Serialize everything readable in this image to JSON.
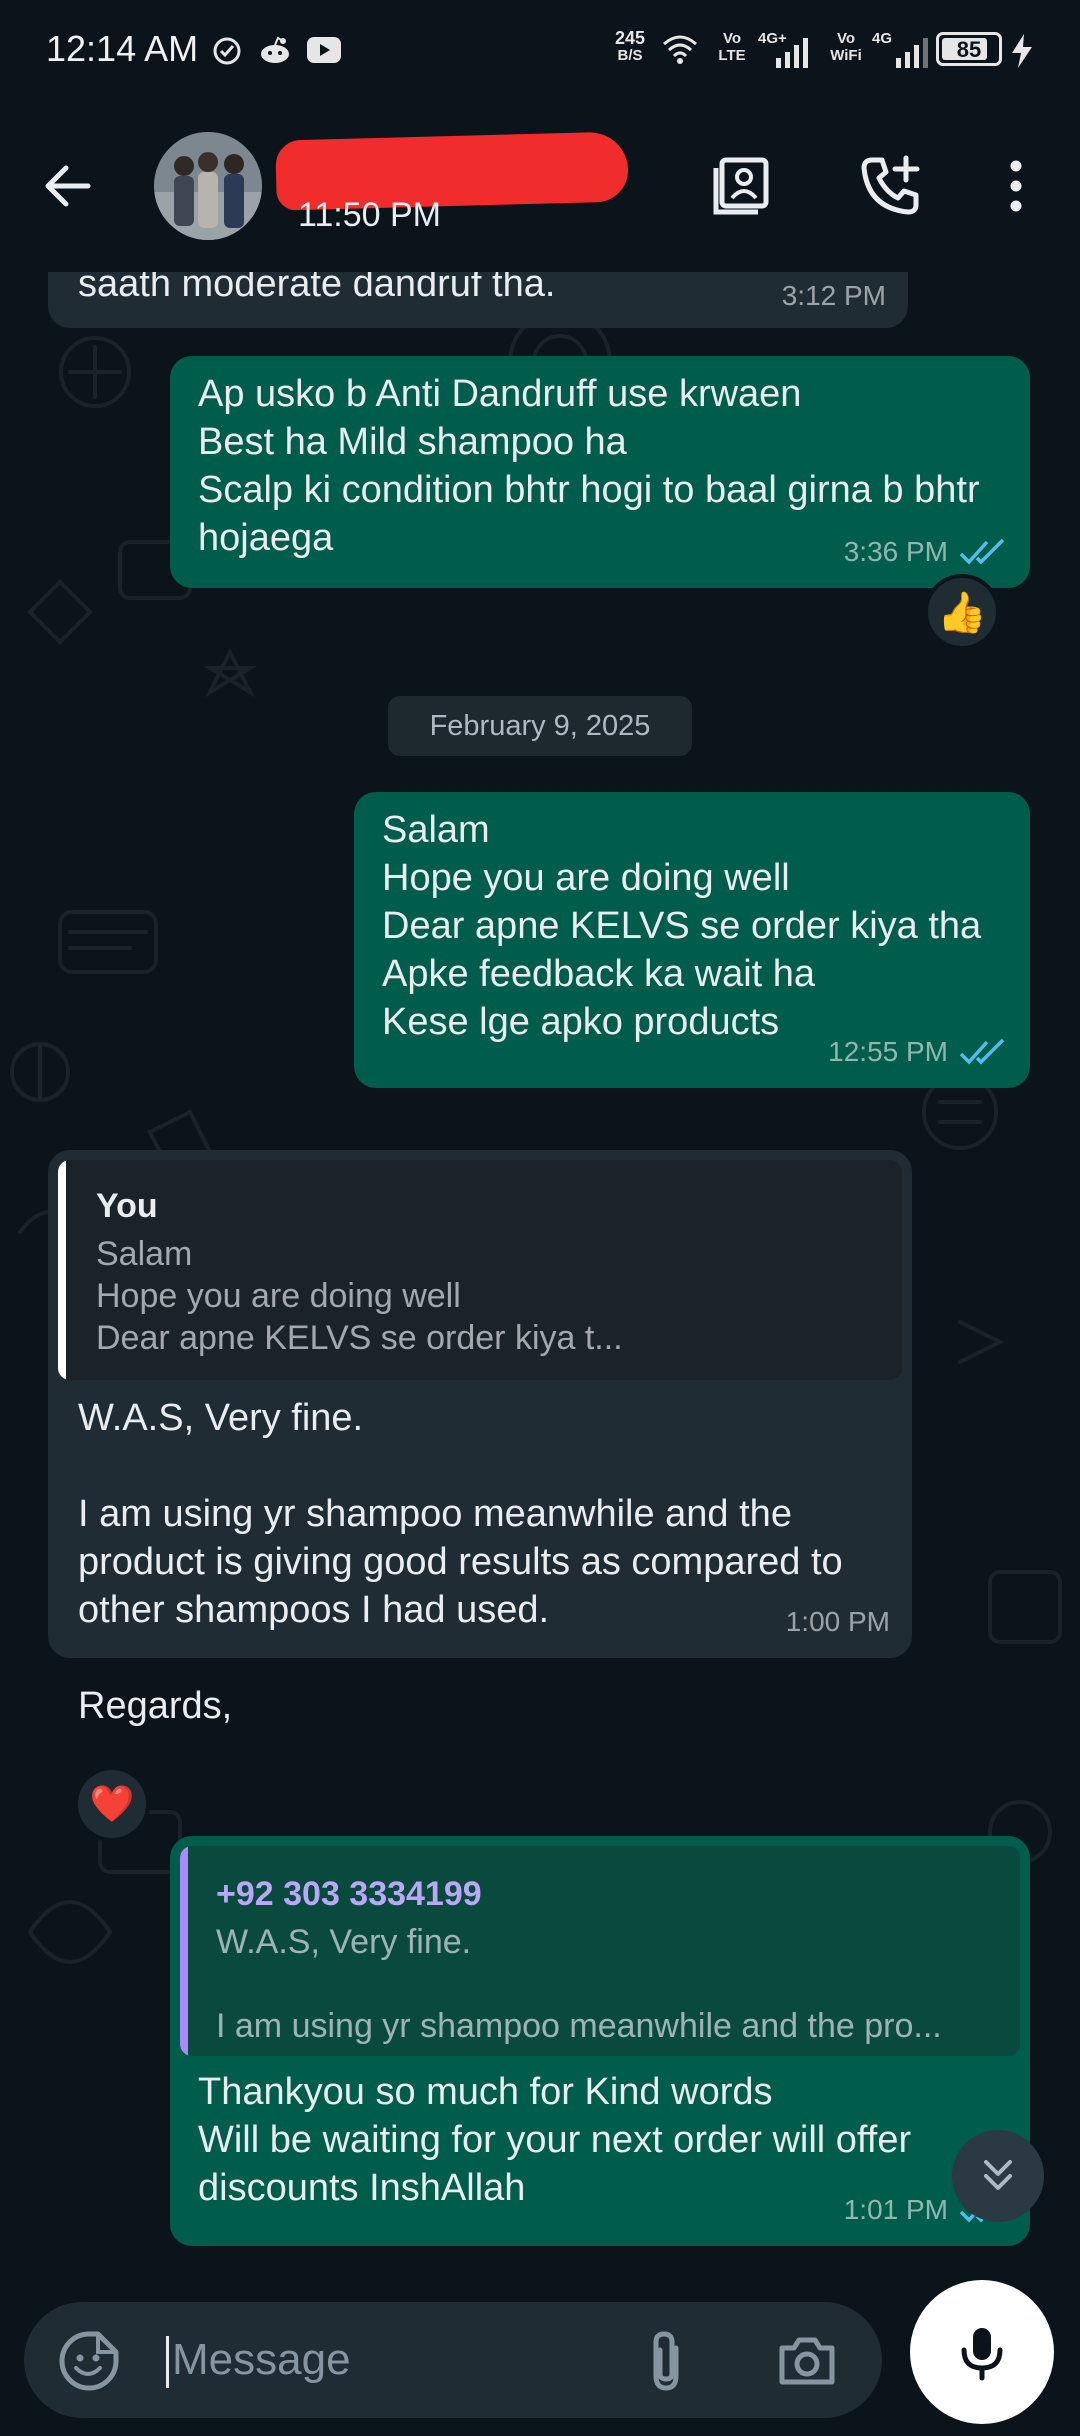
{
  "status_bar": {
    "time": "12:14 AM",
    "net_speed_value": "245",
    "net_speed_unit": "B/S",
    "sim1_label_top": "Vo",
    "sim1_label_bottom": "LTE",
    "sim1_network": "4G+",
    "sim2_label_top": "Vo",
    "sim2_label_bottom": "WiFi",
    "sim2_network": "4G",
    "battery_level": "85",
    "icons": [
      "check-circle-icon",
      "reddit-icon",
      "youtube-icon",
      "wifi-icon",
      "signal-icon",
      "charging-bolt-icon"
    ]
  },
  "header": {
    "last_seen": "11:50 PM",
    "icons": [
      "back-arrow-icon",
      "contact-card-icon",
      "add-call-icon",
      "more-vert-icon"
    ]
  },
  "chat": {
    "messages": [
      {
        "id": "m1",
        "direction": "in",
        "text": "saath moderate dandruf tha.",
        "time": "3:12 PM"
      },
      {
        "id": "m2",
        "direction": "out",
        "text": "Ap usko b Anti Dandruff use krwaen\nBest ha Mild shampoo ha\nScalp ki condition bhtr hogi to baal girna b bhtr hojaega",
        "time": "3:36 PM",
        "status": "read",
        "reaction": "👍"
      },
      {
        "id": "m3",
        "direction": "out",
        "text": "Salam\nHope you are doing well\nDear apne KELVS se order kiya tha\nApke feedback ka wait ha\nKese lge apko products",
        "time": "12:55 PM",
        "status": "read"
      },
      {
        "id": "m4",
        "direction": "in",
        "quote": {
          "author": "You",
          "lines": [
            "Salam",
            "Hope you are doing well",
            "Dear apne KELVS se order kiya t..."
          ]
        },
        "text": "W.A.S, Very fine.\n\nI am using yr shampoo meanwhile and the product is giving good results as compared to other shampoos I had used.\n\nRegards,",
        "time": "1:00 PM",
        "reaction": "❤️"
      },
      {
        "id": "m5",
        "direction": "out",
        "quote": {
          "author": "+92 303 3334199",
          "lines": [
            "W.A.S, Very fine.",
            "",
            "I am using yr shampoo meanwhile and the pro..."
          ]
        },
        "text": "Thankyou so much for Kind words\nWill be waiting for your next order will offer discounts InshAllah",
        "time": "1:01 PM",
        "status": "read"
      }
    ],
    "date_separator": "February 9, 2025"
  },
  "composer": {
    "placeholder": "Message",
    "icons": [
      "sticker-emoji-icon",
      "paperclip-icon",
      "camera-icon",
      "microphone-icon"
    ]
  },
  "colors": {
    "background": "#0b141a",
    "incoming_bubble": "#202c33",
    "outgoing_bubble": "#005c4b",
    "read_ticks": "#53bdeb",
    "quote_bar_you": "#ffffff",
    "quote_bar_contact": "#a78bfa",
    "redaction": "#f02c2c"
  }
}
